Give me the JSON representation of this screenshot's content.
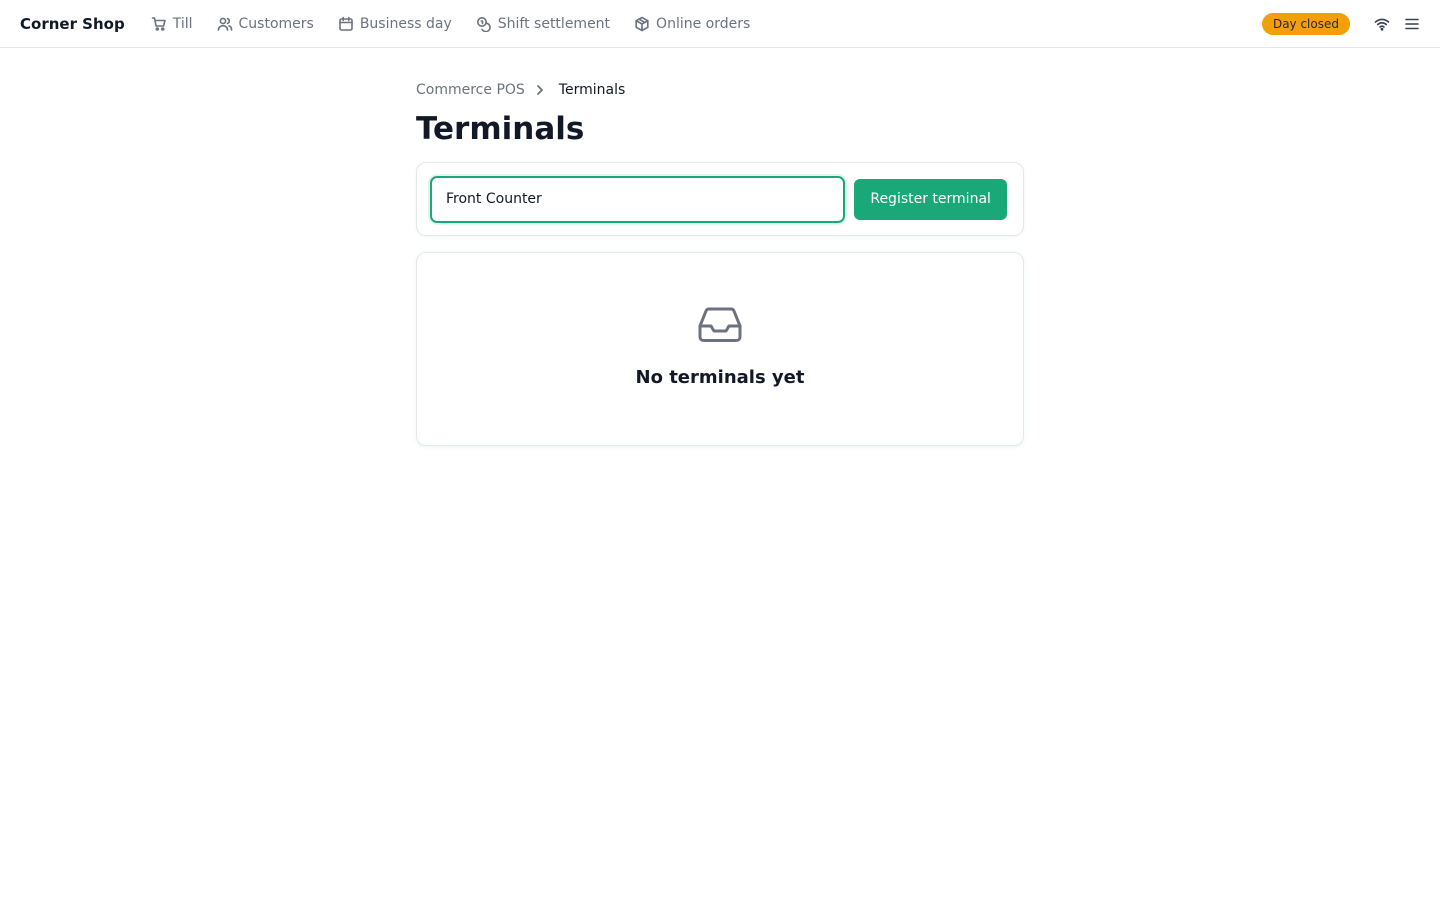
{
  "header": {
    "brand": "Corner Shop",
    "nav": [
      {
        "label": "Till",
        "icon": "cart-icon"
      },
      {
        "label": "Customers",
        "icon": "users-icon"
      },
      {
        "label": "Business day",
        "icon": "calendar-icon"
      },
      {
        "label": "Shift settlement",
        "icon": "coins-icon"
      },
      {
        "label": "Online orders",
        "icon": "package-icon"
      }
    ],
    "status_badge": "Day closed",
    "status_color": "#f59e0b",
    "tools": [
      "wifi-icon",
      "menu-icon"
    ]
  },
  "breadcrumb": {
    "parent": "Commerce POS",
    "current": "Terminals"
  },
  "page": {
    "title": "Terminals"
  },
  "form": {
    "input_value": "Front Counter",
    "button_label": "Register terminal",
    "accent_color": "#1aa879"
  },
  "empty_state": {
    "icon": "inbox-icon",
    "message": "No terminals yet"
  }
}
